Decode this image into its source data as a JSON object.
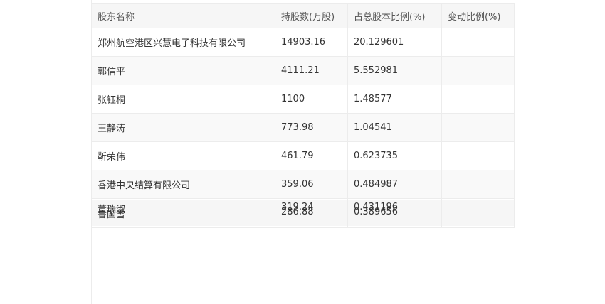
{
  "table": {
    "headers": [
      "股东名称",
      "持股数(万股)",
      "占总股本比例(%)",
      "变动比例(%)"
    ],
    "rows": [
      [
        "郑州航空港区兴慧电子科技有限公司",
        "14903.16",
        "20.129601",
        ""
      ],
      [
        "郭信平",
        "4111.21",
        "5.552981",
        ""
      ],
      [
        "张钰桐",
        "1100",
        "1.48577",
        ""
      ],
      [
        "王静涛",
        "773.98",
        "1.04541",
        ""
      ],
      [
        "靳荣伟",
        "461.79",
        "0.623735",
        ""
      ],
      [
        "香港中央结算有限公司",
        "359.06",
        "0.484987",
        ""
      ]
    ],
    "overlapping_rows": [
      [
        "董瑞淑",
        "319.24",
        "0.431196",
        ""
      ],
      [
        "鲁国雪",
        "286.88",
        "0.389656",
        ""
      ]
    ]
  }
}
